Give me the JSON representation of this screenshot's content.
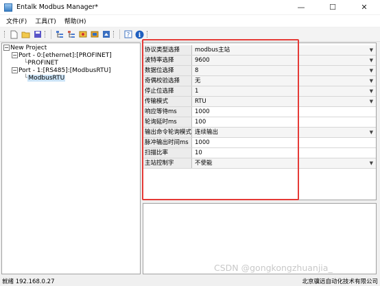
{
  "window": {
    "title": "Entalk Modbus Manager*",
    "minimize": "—",
    "maximize": "☐",
    "close": "✕"
  },
  "menu": [
    "文件(F)",
    "工具(T)",
    "帮助(H)"
  ],
  "tree": {
    "root": "New Project",
    "port0": "Port - 0:[ethernet]:[PROFINET]",
    "port0_child": "PROFINET",
    "port1": "Port - 1:[RS485]:[ModbusRTU]",
    "port1_child": "ModbusRTU"
  },
  "properties": [
    {
      "name": "协议类型选择",
      "value": "modbus主站",
      "dropdown": true
    },
    {
      "name": "波特率选择",
      "value": "9600",
      "dropdown": true
    },
    {
      "name": "数据位选择",
      "value": "8",
      "dropdown": true
    },
    {
      "name": "奇偶校验选择",
      "value": "无",
      "dropdown": true
    },
    {
      "name": "停止位选择",
      "value": "1",
      "dropdown": true
    },
    {
      "name": "传输模式",
      "value": "RTU",
      "dropdown": true
    },
    {
      "name": "响应等待ms",
      "value": "1000",
      "dropdown": false
    },
    {
      "name": "轮询延时ms",
      "value": "100",
      "dropdown": false
    },
    {
      "name": "输出命令轮询模式",
      "value": "连续输出",
      "dropdown": true
    },
    {
      "name": "脉冲输出时间ms",
      "value": "1000",
      "dropdown": false
    },
    {
      "name": "扫描比率",
      "value": "10",
      "dropdown": false
    },
    {
      "name": "主站控制字",
      "value": "不使能",
      "dropdown": true
    }
  ],
  "status": {
    "left": "就绪  192.168.0.27",
    "right": "北京骥远自动化技术有限公司"
  },
  "watermark": "CSDN @gongkongzhuanjia_",
  "colors": {
    "highlight_box": "#e53935",
    "selection": "#cce4f7"
  }
}
